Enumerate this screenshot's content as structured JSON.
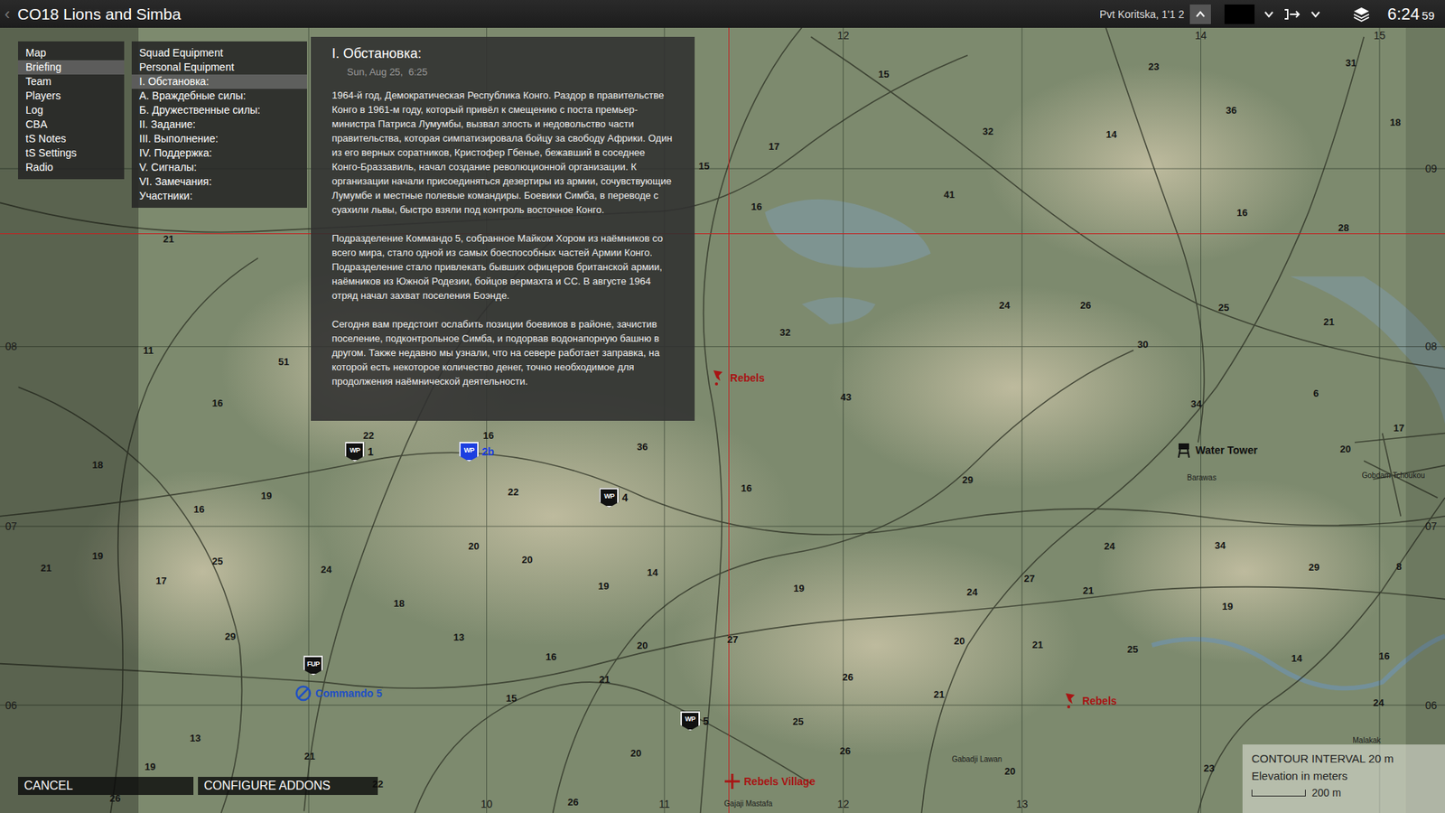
{
  "window": {
    "title": "CO18 Lions and Simba",
    "back": "‹"
  },
  "top_bar": {
    "player": "Pvt Koritska, 1'1 2",
    "time": "6:24",
    "seconds": "59"
  },
  "menu": [
    {
      "label": "Map",
      "selected": false
    },
    {
      "label": "Briefing",
      "selected": true
    },
    {
      "label": "Team",
      "selected": false
    },
    {
      "label": "Players",
      "selected": false
    },
    {
      "label": "Log",
      "selected": false
    },
    {
      "label": "CBA",
      "selected": false
    },
    {
      "label": "tS Notes",
      "selected": false
    },
    {
      "label": "tS Settings",
      "selected": false
    },
    {
      "label": "Radio",
      "selected": false
    }
  ],
  "submenu": [
    {
      "label": "Squad Equipment",
      "selected": false
    },
    {
      "label": "Personal Equipment",
      "selected": false
    },
    {
      "label": "I. Обстановка:",
      "selected": true
    },
    {
      "label": "А. Враждебные силы:",
      "selected": false
    },
    {
      "label": "Б. Дружественные силы:",
      "selected": false
    },
    {
      "label": "II. Задание:",
      "selected": false
    },
    {
      "label": "III. Выполнение:",
      "selected": false
    },
    {
      "label": "IV. Поддержка:",
      "selected": false
    },
    {
      "label": "V. Сигналы:",
      "selected": false
    },
    {
      "label": "VI. Замечания:",
      "selected": false
    },
    {
      "label": "Участники:",
      "selected": false
    }
  ],
  "briefing": {
    "heading": "I. Обстановка:",
    "date": "Sun, Aug 25,  6:25",
    "paragraphs": [
      "1964-й год, Демократическая Республика Конго. Раздор в правительстве Конго в 1961-м году, который привёл к смещению с поста премьер-министра Патриса Лумумбы, вызвал злость и недовольство части правительства, которая симпатизировала бойцу за свободу Африки. Один из его верных соратников, Кристофер Гбенье, бежавший в соседнее Конго-Браззавиль, начал создание революционной организации. К организации начали присоединяться дезертиры из армии, сочувствующие Лумумбе и местные полевые командиры. Боевики Симба, в переводе с суахили львы, быстро взяли под контроль восточное Конго.",
      "Подразделение Коммандо 5, собранное Майком Хором из наёмников со всего мира, стало одной из самых боеспособных частей Армии Конго. Подразделение стало привлекать бывших офицеров британской армии, наёмников из Южной Родезии, бойцов вермахта и СС. В августе 1964 отряд начал захват поселения Боэнде.",
      "Сегодня вам предстоит ослабить позиции боевиков в районе, зачистив поселение, подконтрольное Симба, и подорвав водонапорную башню в другом. Также недавно мы узнали, что на севере работает заправка, на которой есть некоторое количество денег, точно необходимое для продолжения наёмнической деятельности."
    ]
  },
  "buttons": [
    "CANCEL",
    "CONFIGURE ADDONS"
  ],
  "map": {
    "grid_labels": [
      "12",
      "14",
      "15",
      "08",
      "07",
      "06",
      "09",
      "08",
      "07",
      "06",
      "10",
      "11",
      "12",
      "13"
    ],
    "markers": [
      {
        "kind": "waypoint",
        "badge": "WP",
        "label": "1",
        "color": "#111111"
      },
      {
        "kind": "waypoint",
        "badge": "WP",
        "label": "2b",
        "color": "#1c3fe0"
      },
      {
        "kind": "waypoint",
        "badge": "WP",
        "label": "4",
        "color": "#111111"
      },
      {
        "kind": "waypoint",
        "badge": "WP",
        "label": "5",
        "color": "#111111"
      },
      {
        "kind": "waypoint",
        "badge": "FUP",
        "label": "",
        "color": "#111111"
      },
      {
        "kind": "commando",
        "badge": "",
        "label": "Commando 5",
        "color": "#1f4fc4"
      },
      {
        "kind": "flag",
        "badge": "",
        "label": "Rebels",
        "color": "#a81414"
      },
      {
        "kind": "tower",
        "badge": "",
        "label": "Water Tower",
        "color": "#111111"
      },
      {
        "kind": "flag",
        "badge": "",
        "label": "Rebels",
        "color": "#a81414"
      },
      {
        "kind": "cross",
        "badge": "",
        "label": "Rebels Village",
        "color": "#a81414"
      }
    ],
    "elevations": [
      "21",
      "11",
      "51",
      "16",
      "22",
      "18",
      "16",
      "19",
      "21",
      "19",
      "17",
      "25",
      "24",
      "18",
      "29",
      "13",
      "16",
      "20",
      "15",
      "21",
      "13",
      "19",
      "21",
      "22",
      "26",
      "22",
      "20",
      "20",
      "19",
      "14",
      "36",
      "16",
      "20",
      "26",
      "16",
      "27",
      "19",
      "26",
      "25",
      "26",
      "15",
      "17",
      "15",
      "16",
      "32",
      "14",
      "41",
      "23",
      "36",
      "31",
      "18",
      "16",
      "28",
      "24",
      "26",
      "25",
      "21",
      "32",
      "43",
      "30",
      "34",
      "6",
      "29",
      "24",
      "34",
      "29",
      "8",
      "27",
      "21",
      "24",
      "19",
      "20",
      "21",
      "25",
      "21",
      "14",
      "16",
      "24",
      "20",
      "17",
      "20",
      "23"
    ],
    "places": [
      "Barawas",
      "Gobdam Tchoukou",
      "Gabadji Lawan",
      "Gajaji Mastafa",
      "Malakak"
    ],
    "legend": {
      "title": "CONTOUR INTERVAL 20 m",
      "subtitle": "Elevation in meters",
      "scale": "200 m"
    }
  }
}
